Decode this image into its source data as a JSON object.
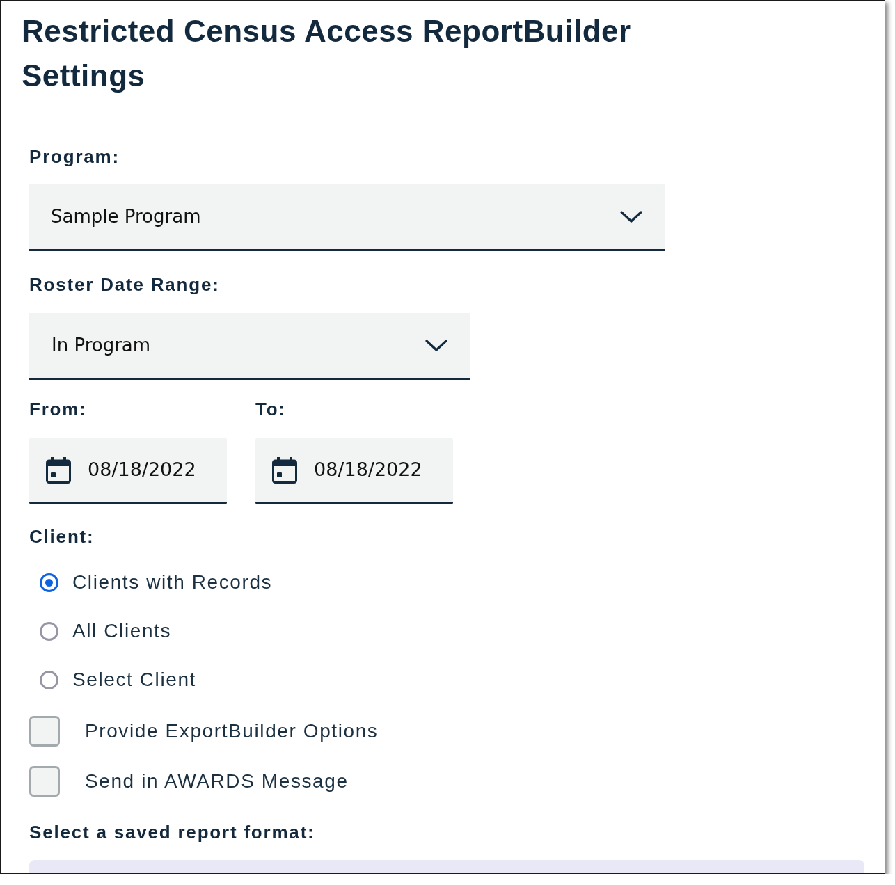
{
  "title": "Restricted Census Access ReportBuilder Settings",
  "program": {
    "label": "Program:",
    "value": "Sample Program"
  },
  "roster_date_range": {
    "label": "Roster Date Range:",
    "value": "In Program"
  },
  "date_from": {
    "label": "From:",
    "value": "08/18/2022"
  },
  "date_to": {
    "label": "To:",
    "value": "08/18/2022"
  },
  "client": {
    "label": "Client:",
    "options": [
      {
        "label": "Clients with Records",
        "selected": true
      },
      {
        "label": "All Clients",
        "selected": false
      },
      {
        "label": "Select Client",
        "selected": false
      }
    ]
  },
  "checkboxes": [
    {
      "label": "Provide ExportBuilder Options",
      "checked": false
    },
    {
      "label": "Send in AWARDS Message",
      "checked": false
    }
  ],
  "report_format": {
    "label": "Select a saved report format:"
  }
}
